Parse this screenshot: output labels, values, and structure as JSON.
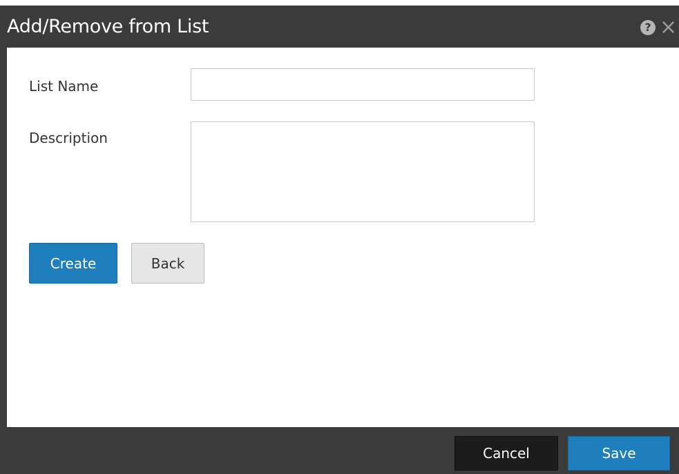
{
  "dialog": {
    "title": "Add/Remove from List",
    "help_icon": "?",
    "close_icon": "×"
  },
  "form": {
    "list_name_label": "List Name",
    "list_name_value": "",
    "description_label": "Description",
    "description_value": "",
    "create_label": "Create",
    "back_label": "Back"
  },
  "footer": {
    "cancel_label": "Cancel",
    "save_label": "Save"
  },
  "colors": {
    "titlebar": "#3b3b3b",
    "primary": "#1f7fbd",
    "cancel": "#1c1c1c"
  }
}
